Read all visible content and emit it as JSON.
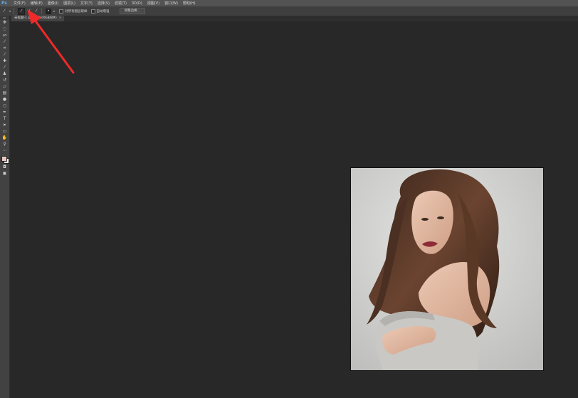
{
  "app": {
    "logo": "Ps"
  },
  "menu": [
    {
      "label": "文件(F)"
    },
    {
      "label": "编辑(E)"
    },
    {
      "label": "图像(I)"
    },
    {
      "label": "图层(L)"
    },
    {
      "label": "文字(Y)"
    },
    {
      "label": "选择(S)"
    },
    {
      "label": "滤镜(T)"
    },
    {
      "label": "3D(D)"
    },
    {
      "label": "视图(V)"
    },
    {
      "label": "窗口(W)"
    },
    {
      "label": "帮助(H)"
    }
  ],
  "options": {
    "sample_all_layers": "对所有图层取样",
    "auto_enhance": "自动增强",
    "refine_edge": "调整边缘..."
  },
  "document": {
    "tab_title": "未标题-1 @ 100%(RGB/8#)",
    "close_glyph": "×"
  },
  "colors": {
    "foreground": "#e8c9c0",
    "background": "#f4f4f4",
    "annotation_arrow": "#ee2a2a"
  },
  "tools": [
    "move-icon",
    "marquee-icon",
    "lasso-icon",
    "quick-selection-icon",
    "crop-icon",
    "eyedropper-icon",
    "healing-brush-icon",
    "brush-icon",
    "clone-stamp-icon",
    "history-brush-icon",
    "eraser-icon",
    "gradient-icon",
    "blur-icon",
    "dodge-icon",
    "pen-icon",
    "type-icon",
    "path-selection-icon",
    "shape-icon",
    "hand-icon",
    "zoom-icon"
  ]
}
